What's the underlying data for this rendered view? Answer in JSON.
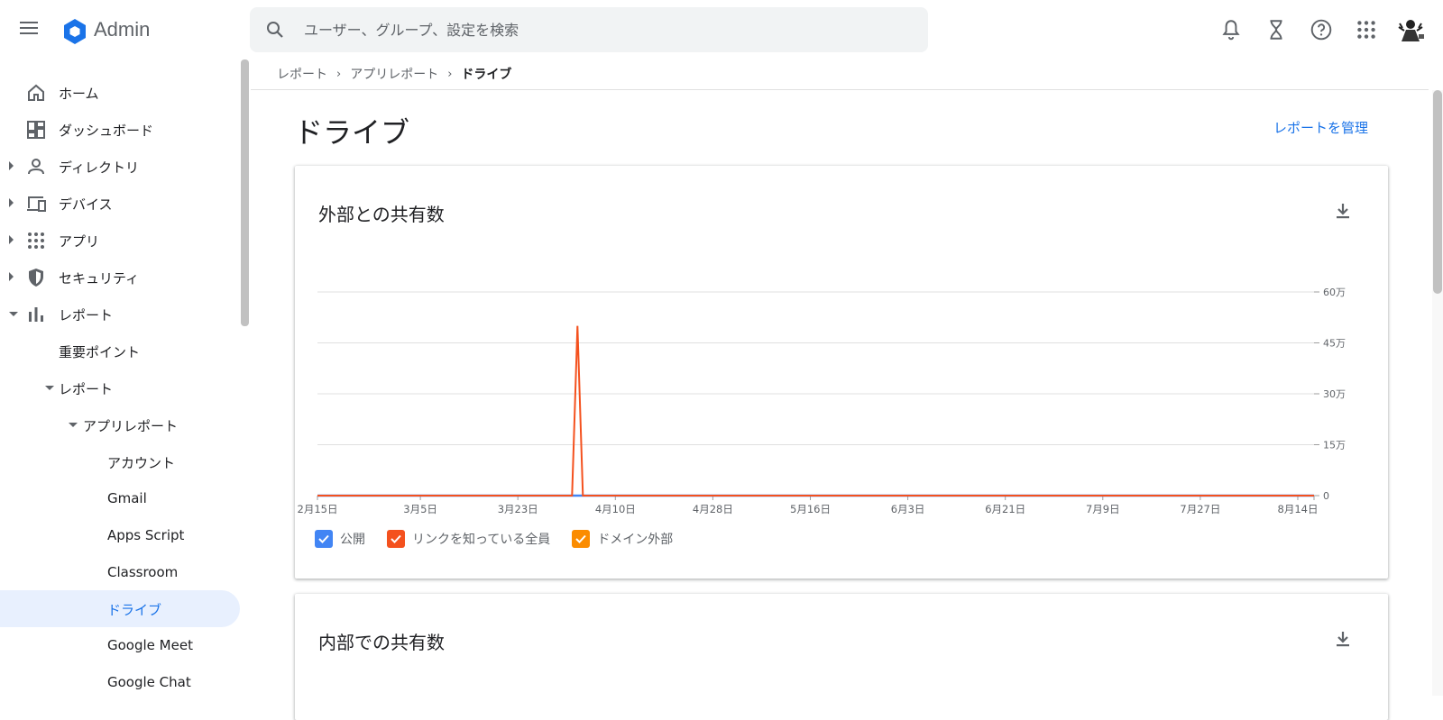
{
  "app": {
    "title": "Admin"
  },
  "search": {
    "placeholder": "ユーザー、グループ、設定を検索"
  },
  "sidebar": {
    "items": [
      {
        "label": "ホーム",
        "icon": "home-icon"
      },
      {
        "label": "ダッシュボード",
        "icon": "dashboard-icon"
      },
      {
        "label": "ディレクトリ",
        "icon": "person-icon"
      },
      {
        "label": "デバイス",
        "icon": "devices-icon"
      },
      {
        "label": "アプリ",
        "icon": "apps-grid-icon"
      },
      {
        "label": "セキュリティ",
        "icon": "shield-icon"
      },
      {
        "label": "レポート",
        "icon": "bar-chart-icon"
      },
      {
        "label": "重要ポイント"
      },
      {
        "label": "レポート"
      },
      {
        "label": "アプリレポート"
      },
      {
        "label": "アカウント"
      },
      {
        "label": "Gmail"
      },
      {
        "label": "Apps Script"
      },
      {
        "label": "Classroom"
      },
      {
        "label": "ドライブ"
      },
      {
        "label": "Google Meet"
      },
      {
        "label": "Google Chat"
      }
    ]
  },
  "breadcrumb": {
    "items": [
      "レポート",
      "アプリレポート",
      "ドライブ"
    ]
  },
  "page": {
    "title": "ドライブ",
    "manage_link": "レポートを管理"
  },
  "cards": [
    {
      "title": "外部との共有数"
    },
    {
      "title": "内部での共有数"
    }
  ],
  "colors": {
    "accent": "#1a73e8",
    "series_public": "#4285f4",
    "series_anyone": "#f4511e",
    "series_external": "#fb8c00"
  },
  "chart_data": {
    "type": "line",
    "x_labels": [
      "2月15日",
      "3月5日",
      "3月23日",
      "4月10日",
      "4月28日",
      "5月16日",
      "6月3日",
      "6月21日",
      "7月9日",
      "7月27日",
      "8月14日"
    ],
    "y_ticks": [
      "0",
      "15万",
      "30万",
      "45万",
      "60万"
    ],
    "ylim": [
      0,
      600000
    ],
    "xlim": [
      "2月15日",
      "8月17日"
    ],
    "series": [
      {
        "name": "公開",
        "color": "#4285f4",
        "points": [
          [
            "2月15日",
            0
          ],
          [
            "8月17日",
            0
          ]
        ]
      },
      {
        "name": "リンクを知っている全員",
        "color": "#f4511e",
        "points": [
          [
            "2月15日",
            0
          ],
          [
            "4月2日",
            0
          ],
          [
            "4月3日",
            500000
          ],
          [
            "4月4日",
            0
          ],
          [
            "8月17日",
            0
          ]
        ]
      },
      {
        "name": "ドメイン外部",
        "color": "#fb8c00",
        "points": [
          [
            "2月15日",
            0
          ],
          [
            "8月17日",
            0
          ]
        ]
      }
    ],
    "legend_position": "bottom-left",
    "grid": true
  }
}
